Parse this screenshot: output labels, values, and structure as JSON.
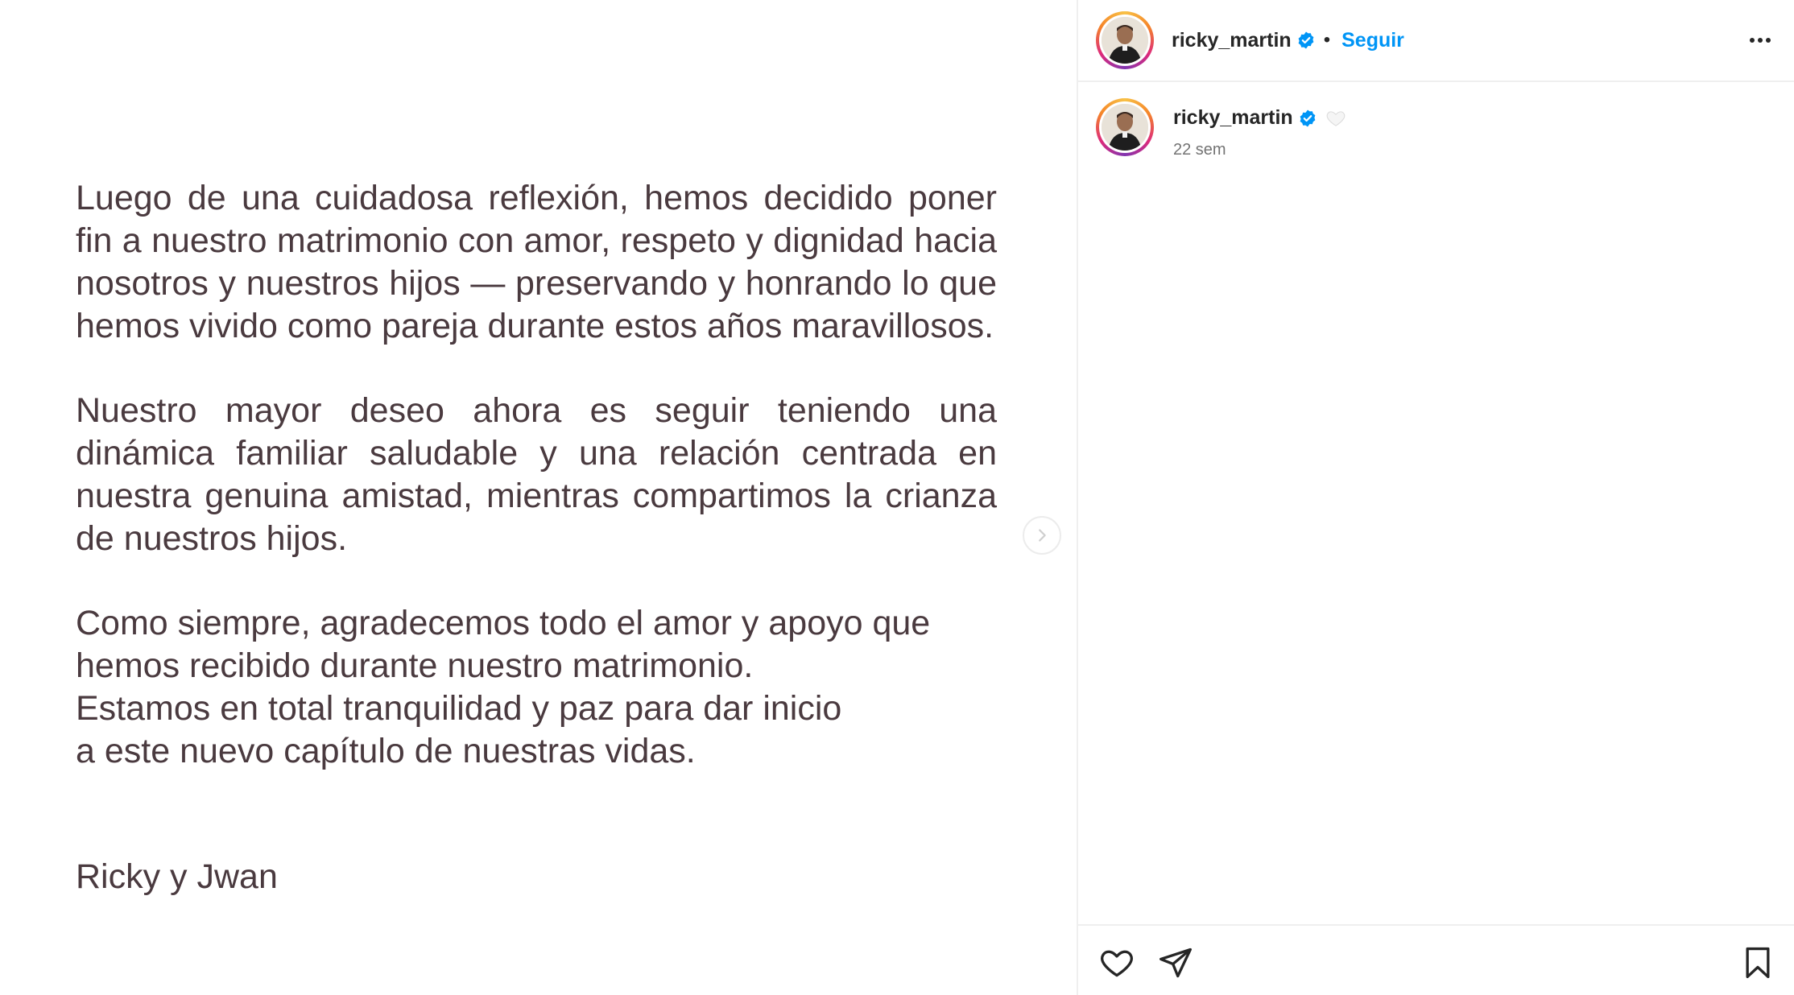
{
  "post": {
    "paragraphs": [
      "Luego de una cuidadosa reflexión, hemos decidido poner fin a nuestro matrimonio con amor, respeto y dignidad hacia nosotros y nuestros hijos — preservando y honrando lo que hemos vivido como pareja durante estos años maravillosos.",
      "Nuestro mayor deseo ahora es seguir teniendo una dinámica familiar saludable y una relación centrada en nuestra genuina amistad, mientras compartimos la crianza de nuestros hijos.",
      "Como siempre, agradecemos todo el amor y apoyo que hemos recibido durante nuestro matrimonio."
    ],
    "closing_lines": [
      "Estamos en total tranquilidad y paz para dar inicio",
      "a este nuevo capítulo de nuestras vidas."
    ],
    "signature": "Ricky y Jwan"
  },
  "header": {
    "username": "ricky_martin",
    "separator": "•",
    "follow_label": "Seguir"
  },
  "caption": {
    "username": "ricky_martin",
    "time": "22 sem"
  },
  "icons": {
    "verified": "verified-badge-icon",
    "more": "more-options-icon",
    "next": "chevron-right-icon",
    "like": "heart-icon",
    "share": "paper-plane-icon",
    "save": "bookmark-icon",
    "caption_emoji": "white-heart-icon"
  },
  "colors": {
    "accent": "#0095f6",
    "text": "#262626",
    "muted": "#737373",
    "statement_text": "#4a3a3f",
    "border": "#efefef"
  }
}
